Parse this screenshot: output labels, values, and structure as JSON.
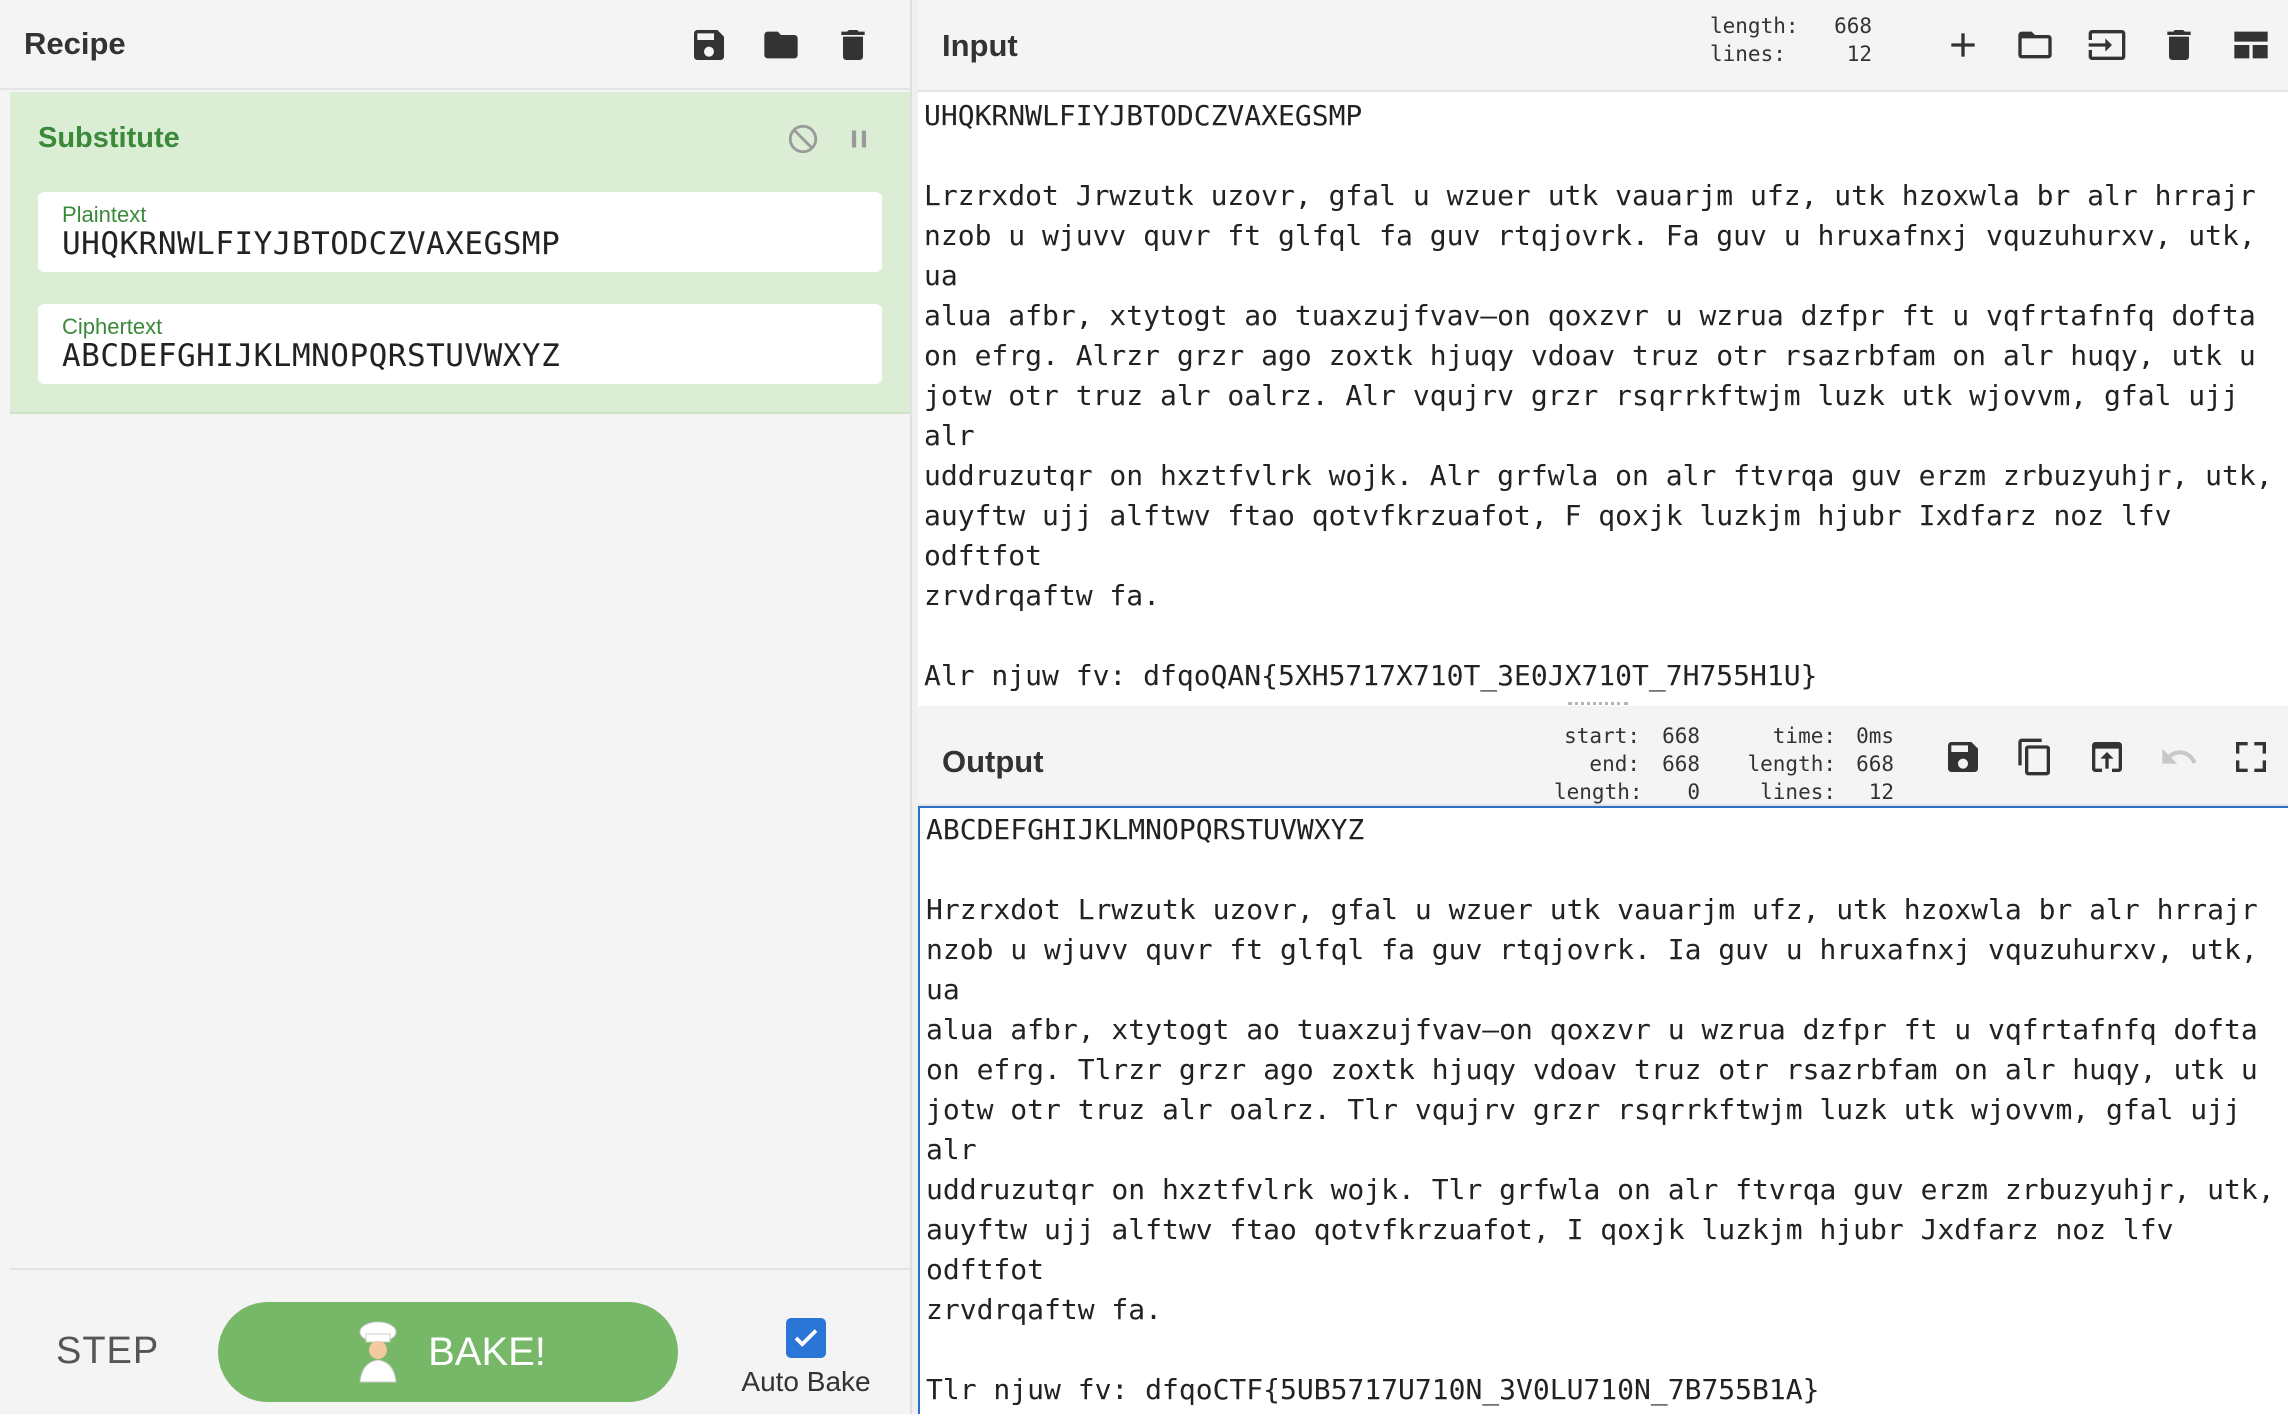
{
  "recipe": {
    "title": "Recipe",
    "toolbar": [
      "save-icon",
      "folder-icon",
      "trash-icon"
    ],
    "operation": {
      "name": "Substitute",
      "plaintext_label": "Plaintext",
      "plaintext_value": "UHQKRNWLFIYJBTODCZVAXEGSMP",
      "ciphertext_label": "Ciphertext",
      "ciphertext_value": "ABCDEFGHIJKLMNOPQRSTUVWXYZ"
    },
    "controls": {
      "step_label": "STEP",
      "bake_label": "BAKE!",
      "autobake_label": "Auto Bake",
      "autobake_checked": true
    }
  },
  "input": {
    "title": "Input",
    "length_label": "length:",
    "length_value": "668",
    "lines_label": "lines:",
    "lines_value": "12",
    "text": "UHQKRNWLFIYJBTODCZVAXEGSMP\n\nLrzrxdot Jrwzutk uzovr, gfal u wzuer utk vauarjm ufz, utk hzoxwla br alr hrrajr nzob u wjuvv quvr ft glfql fa guv rtqjovrk. Fa guv u hruxafnxj vquzuhurxv, utk, ua\nalua afbr, xtytogt ao tuaxzujfvav—on qoxzvr u wzrua dzfpr ft u vqfrtafnfq dofta on efrg. Alrzr grzr ago zoxtk hjuqy vdoav truz otr rsazrbfam on alr huqy, utk u jotw otr truz alr oalrz. Alr vqujrv grzr rsqrrkftwjm luzk utk wjovvm, gfal ujj alr\nuddruzutqr on hxztfvlrk wojk. Alr grfwla on alr ftvrqa guv erzm zrbuzyuhjr, utk, auyftw ujj alftwv ftao qotvfkrzuafot, F qoxjk luzkjm hjubr Ixdfarz noz lfv odftfot\nzrvdrqaftw fa.\n\nAlr njuw fv: dfqoQAN{5XH5717X710T_3E0JX710T_7H755H1U}"
  },
  "output": {
    "title": "Output",
    "start_label": "start:",
    "start_value": "668",
    "end_label": "end:",
    "end_value": "668",
    "sel_length_label": "length:",
    "sel_length_value": "0",
    "time_label": "time:",
    "time_value": "0ms",
    "length_label": "length:",
    "length_value": "668",
    "lines_label": "lines:",
    "lines_value": "12",
    "text": "ABCDEFGHIJKLMNOPQRSTUVWXYZ\n\nHrzrxdot Lrwzutk uzovr, gfal u wzuer utk vauarjm ufz, utk hzoxwla br alr hrrajr nzob u wjuvv quvr ft glfql fa guv rtqjovrk. Ia guv u hruxafnxj vquzuhurxv, utk, ua\nalua afbr, xtytogt ao tuaxzujfvav—on qoxzvr u wzrua dzfpr ft u vqfrtafnfq dofta on efrg. Tlrzr grzr ago zoxtk hjuqy vdoav truz otr rsazrbfam on alr huqy, utk u jotw otr truz alr oalrz. Tlr vqujrv grzr rsqrrkftwjm luzk utk wjovvm, gfal ujj alr\nuddruzutqr on hxztfvlrk wojk. Tlr grfwla on alr ftvrqa guv erzm zrbuzyuhjr, utk, auyftw ujj alftwv ftao qotvfkrzuafot, I qoxjk luzkjm hjubr Jxdfarz noz lfv odftfot\nzrvdrqaftw fa.\n\nTlr njuw fv: dfqoCTF{5UB5717U710N_3V0LU710N_7B755B1A}"
  },
  "colors": {
    "accent_green": "#77b868",
    "op_bg": "#dcedd5",
    "label_green": "#3a8a3a",
    "checkbox_blue": "#2a75d6"
  }
}
